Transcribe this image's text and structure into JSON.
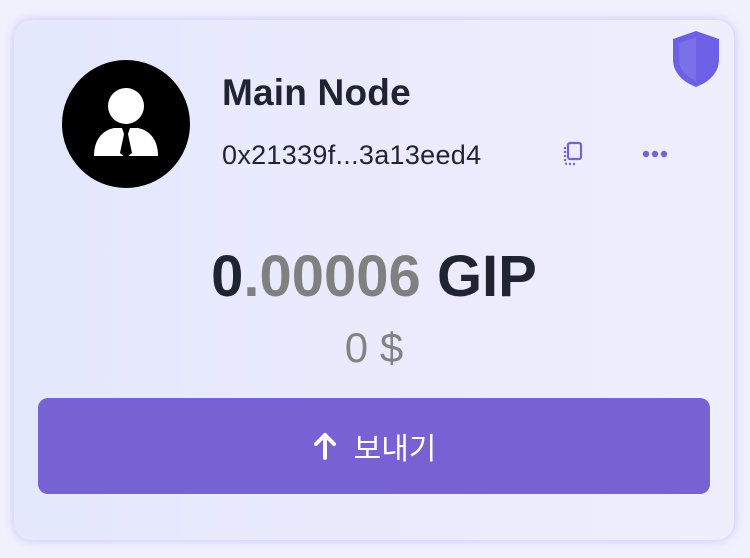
{
  "wallet": {
    "node_name": "Main Node",
    "address": "0x21339f...3a13eed4",
    "balance_whole": "0",
    "balance_frac": ".00006",
    "balance_unit": "GIP",
    "fiat_value": "0 $"
  },
  "actions": {
    "send_label": "보내기"
  },
  "icons": {
    "shield": "shield-icon",
    "avatar": "user-avatar-icon",
    "copy": "copy-icon",
    "more": "more-horizontal-icon",
    "send": "arrow-up-icon"
  },
  "colors": {
    "accent": "#7762d3",
    "shield": "#6c61e4",
    "text_dark": "#1f2430",
    "text_muted": "#808080"
  }
}
